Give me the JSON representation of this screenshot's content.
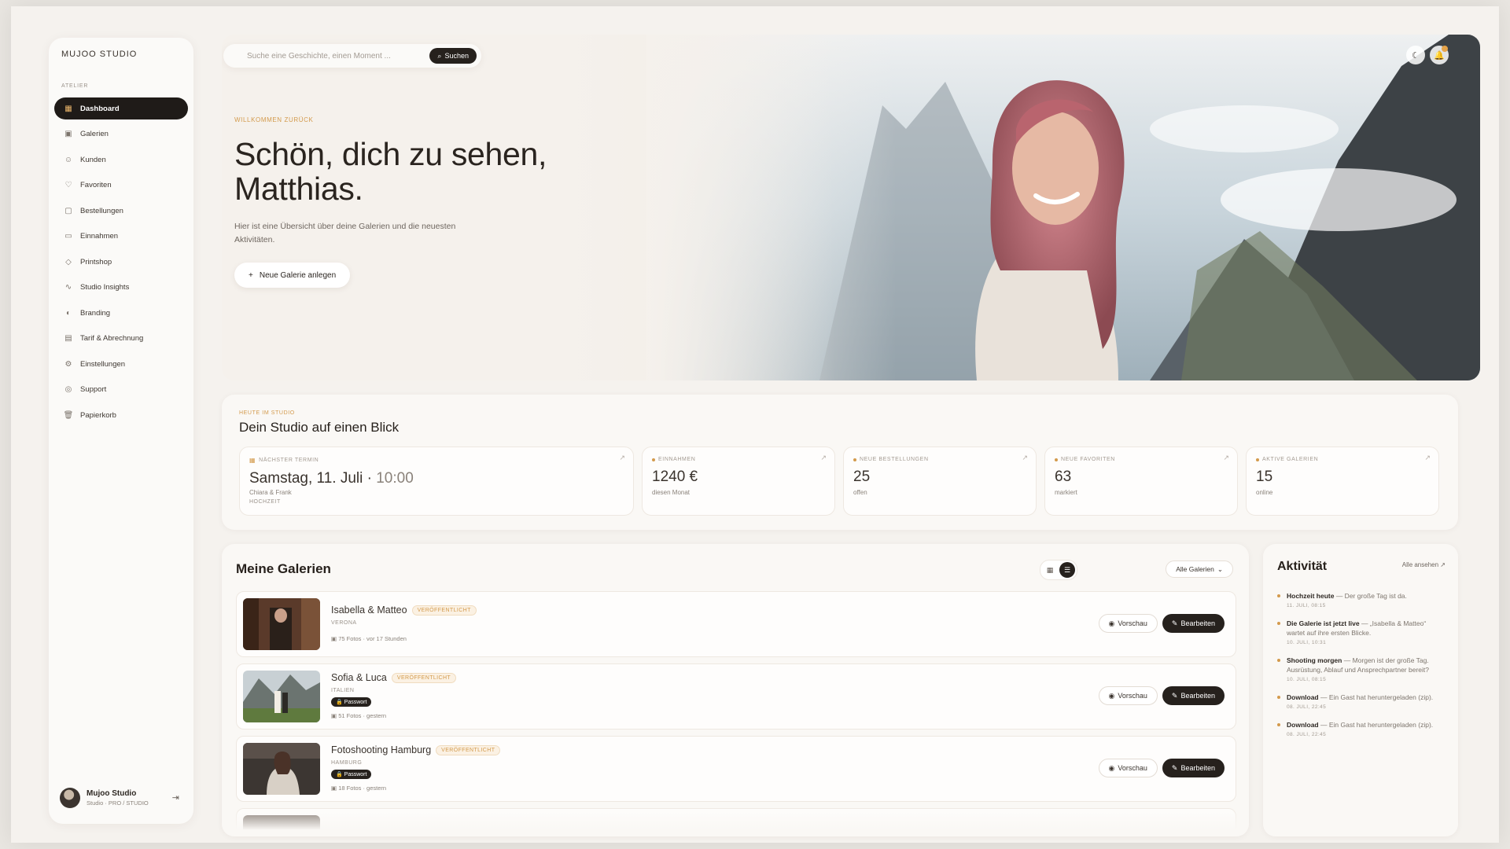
{
  "sidebar": {
    "brand": "MUJOO STUDIO",
    "section": "ATELIER",
    "items": [
      {
        "label": "Dashboard",
        "icon": "grid-icon",
        "active": true
      },
      {
        "label": "Galerien",
        "icon": "images-icon"
      },
      {
        "label": "Kunden",
        "icon": "users-icon"
      },
      {
        "label": "Favoriten",
        "icon": "heart-icon"
      },
      {
        "label": "Bestellungen",
        "icon": "bag-icon"
      },
      {
        "label": "Einnahmen",
        "icon": "wallet-icon"
      },
      {
        "label": "Printshop",
        "icon": "tag-icon"
      },
      {
        "label": "Studio Insights",
        "icon": "pulse-icon"
      },
      {
        "label": "Branding",
        "icon": "palette-icon"
      },
      {
        "label": "Tarif & Abrechnung",
        "icon": "receipt-icon"
      },
      {
        "label": "Einstellungen",
        "icon": "gear-icon"
      },
      {
        "label": "Support",
        "icon": "lifebuoy-icon"
      },
      {
        "label": "Papierkorb",
        "icon": "trash-icon"
      }
    ],
    "profile": {
      "name": "Mujoo Studio",
      "plan": "Studio · PRO / STUDIO"
    }
  },
  "search": {
    "placeholder": "Suche eine Geschichte, einen Moment ...",
    "button": "Suchen"
  },
  "hero": {
    "welcome": "WILLKOMMEN ZURÜCK",
    "title_line1": "Schön, dich zu sehen,",
    "title_line2": "Matthias.",
    "subtitle": "Hier ist eine Übersicht über deine Galerien und die neuesten Aktivitäten.",
    "cta": "Neue Galerie anlegen"
  },
  "overview": {
    "label": "HEUTE IM STUDIO",
    "title": "Dein Studio auf einen Blick",
    "next": {
      "label": "NÄCHSTER TERMIN",
      "date": "Samstag, 11. Juli",
      "time": "10:00",
      "client": "Chiara & Frank",
      "type": "HOCHZEIT"
    },
    "stats": [
      {
        "label": "EINNAHMEN",
        "value": "1240 €",
        "sub": "diesen Monat"
      },
      {
        "label": "NEUE BESTELLUNGEN",
        "value": "25",
        "sub": "offen"
      },
      {
        "label": "NEUE FAVORITEN",
        "value": "63",
        "sub": "markiert"
      },
      {
        "label": "AKTIVE GALERIEN",
        "value": "15",
        "sub": "online"
      }
    ]
  },
  "galleries": {
    "title": "Meine Galerien",
    "filter": "Alle Galerien",
    "preview_label": "Vorschau",
    "edit_label": "Bearbeiten",
    "status_label": "VERÖFFENTLICHT",
    "password_label": "Passwort",
    "rows": [
      {
        "name": "Isabella & Matteo",
        "location": "VERONA",
        "photos": "75 Fotos",
        "updated": "vor 17 Stunden",
        "password": false
      },
      {
        "name": "Sofia & Luca",
        "location": "ITALIEN",
        "photos": "51 Fotos",
        "updated": "gestern",
        "password": true
      },
      {
        "name": "Fotoshooting Hamburg",
        "location": "HAMBURG",
        "photos": "18 Fotos",
        "updated": "gestern",
        "password": true
      }
    ]
  },
  "activity": {
    "title": "Aktivität",
    "all": "Alle ansehen",
    "items": [
      {
        "strong": "Hochzeit heute",
        "text": " — Der große Tag ist da.",
        "time": "11. JULI, 08:15"
      },
      {
        "strong": "Die Galerie ist jetzt live",
        "text": " — „Isabella & Matteo“ wartet auf ihre ersten Blicke.",
        "time": "10. JULI, 10:31"
      },
      {
        "strong": "Shooting morgen",
        "text": " — Morgen ist der große Tag. Ausrüstung, Ablauf und Ansprechpartner bereit?",
        "time": "10. JULI, 08:15"
      },
      {
        "strong": "Download",
        "text": " — Ein Gast hat heruntergeladen (zip).",
        "time": "08. JULI, 22:45"
      },
      {
        "strong": "Download",
        "text": " — Ein Gast hat heruntergeladen (zip).",
        "time": "08. JULI, 22:45"
      }
    ]
  },
  "colors": {
    "accent": "#d39a4c",
    "dark": "#26211d",
    "background": "#f5f2ee"
  }
}
